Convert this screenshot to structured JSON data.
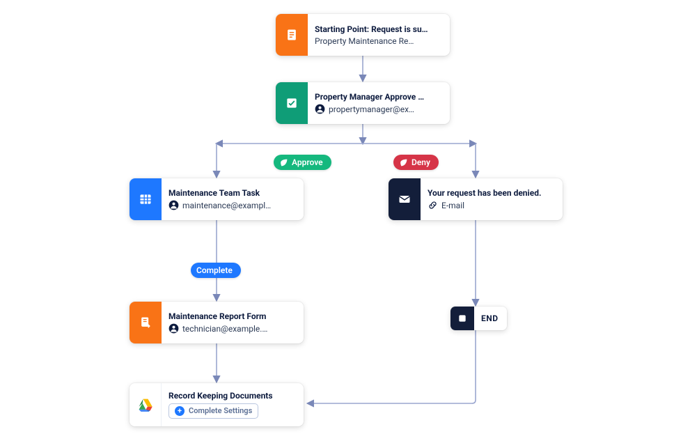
{
  "nodes": {
    "start": {
      "title": "Starting Point: Request is su…",
      "subtitle": "Property Maintenance Re…"
    },
    "approval": {
      "title": "Property Manager Approve …",
      "subtitle": "propertymanager@ex…"
    },
    "task": {
      "title": "Maintenance Team Task",
      "subtitle": "maintenance@exampl…"
    },
    "report": {
      "title": "Maintenance Report Form",
      "subtitle": "technician@example.…"
    },
    "denied": {
      "title": "Your request has been denied.",
      "subtitle": "E-mail"
    },
    "record": {
      "title": "Record Keeping Documents",
      "settings_label": "Complete Settings"
    },
    "end": {
      "label": "END"
    }
  },
  "edges": {
    "approve": "Approve",
    "deny": "Deny",
    "complete": "Complete"
  }
}
